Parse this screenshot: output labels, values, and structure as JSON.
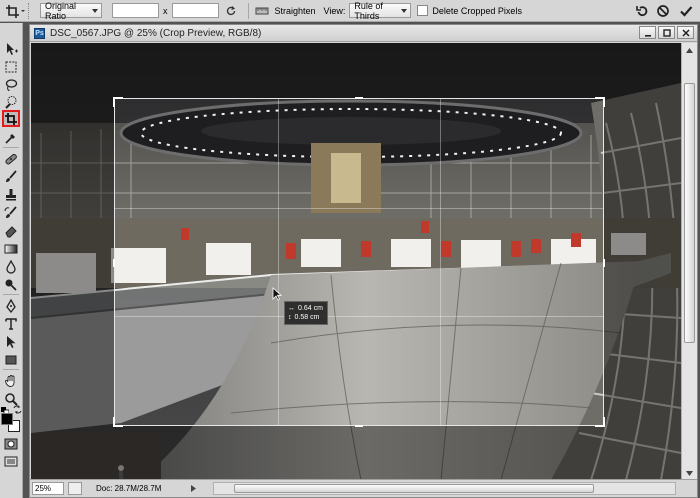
{
  "options_bar": {
    "ratio_select": "Original Ratio",
    "width_value": "",
    "separator": "x",
    "height_value": "",
    "straighten_label": "Straighten",
    "view_label": "View:",
    "view_select": "Rule of Thirds",
    "delete_cropped_label": "Delete Cropped Pixels",
    "delete_cropped_checked": false
  },
  "document": {
    "title": "DSC_0567.JPG @ 25% (Crop Preview, RGB/8)",
    "zoom": "25%",
    "doc_size": "Doc: 28.7M/28.7M"
  },
  "crop_tooltip": {
    "w_symbol": "↔",
    "w_value": "0.64 cm",
    "h_symbol": "↕",
    "h_value": "0.58 cm"
  },
  "colors": {
    "active_tool_outline": "#e31b1b",
    "foreground": "#000000",
    "background": "#ffffff"
  }
}
